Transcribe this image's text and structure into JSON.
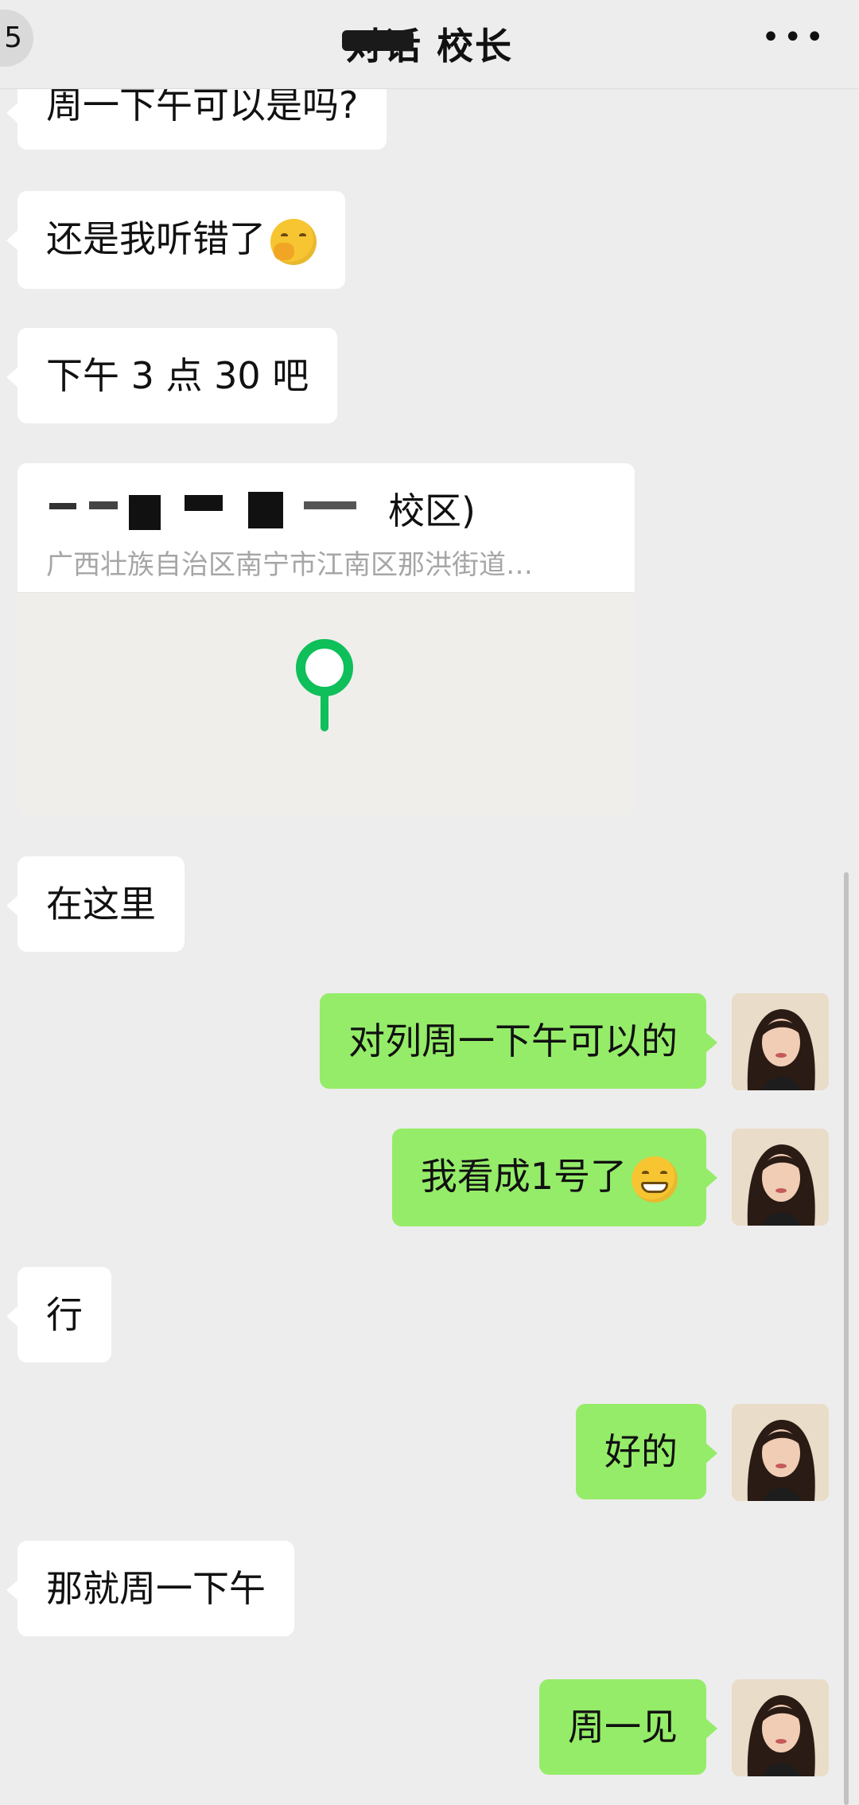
{
  "header": {
    "back_count": "5",
    "title": "对话 校长",
    "more_label": "•••"
  },
  "messages": [
    {
      "side": "in",
      "text": "周一下午可以是吗?"
    },
    {
      "side": "in",
      "text": "还是我听错了",
      "emoji": "face-with-hand-over-mouth"
    },
    {
      "side": "in",
      "text": "下午 3 点 30 吧"
    },
    {
      "side": "in",
      "type": "location",
      "name": "校区)",
      "address": "广西壮族自治区南宁市江南区那洪街道…"
    },
    {
      "side": "in",
      "text": "在这里"
    },
    {
      "side": "out",
      "text": "对列周一下午可以的"
    },
    {
      "side": "out",
      "text": "我看成1号了",
      "emoji": "grinning-face"
    },
    {
      "side": "in",
      "text": "行"
    },
    {
      "side": "out",
      "text": "好的"
    },
    {
      "side": "in",
      "text": "那就周一下午"
    },
    {
      "side": "out",
      "text": "周一见"
    }
  ],
  "colors": {
    "background": "#ededed",
    "incoming_bubble": "#ffffff",
    "outgoing_bubble": "#95ec69",
    "location_pin": "#0fbf5a"
  }
}
